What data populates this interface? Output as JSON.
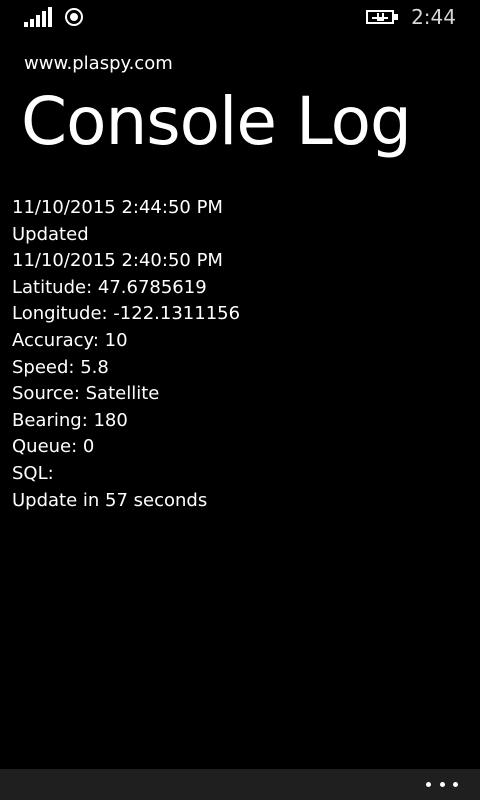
{
  "status_bar": {
    "time": "2:44",
    "signal_icon": "signal-strength-icon",
    "location_icon": "location-icon",
    "battery_icon": "battery-charging-icon"
  },
  "header": {
    "app_name": "www.plaspy.com",
    "page_title": "Console Log"
  },
  "log_lines": [
    "11/10/2015 2:44:50 PM",
    "Updated",
    "11/10/2015 2:40:50 PM",
    "Latitude: 47.6785619",
    "Longitude: -122.1311156",
    "Accuracy: 10",
    "Speed: 5.8",
    "Source: Satellite",
    "Bearing: 180",
    "Queue: 0",
    "SQL:",
    "Update in 57 seconds"
  ],
  "app_bar": {
    "more_icon": "ellipsis-icon"
  },
  "colors": {
    "background": "#000000",
    "text": "#ffffff",
    "app_bar": "#1f1f1f"
  }
}
